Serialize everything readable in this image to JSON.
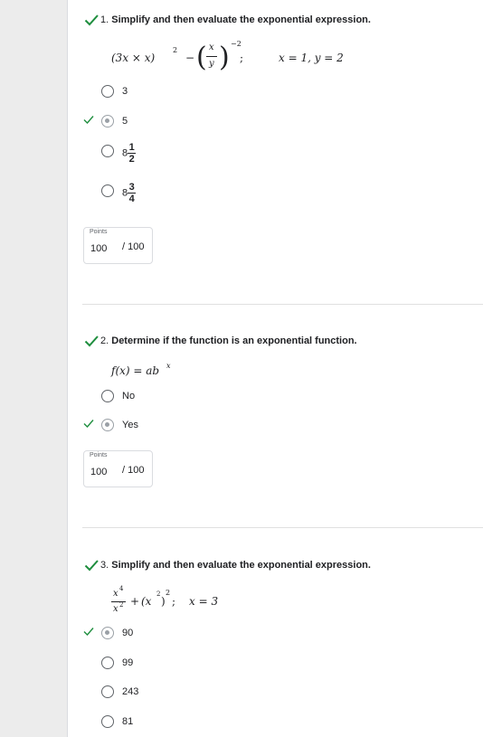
{
  "colors": {
    "check": "#1e8e3e",
    "selected_radio": "#9aa0a6",
    "divider": "#e0e0e0"
  },
  "questions": [
    {
      "number": "1.",
      "title": "Simplify and then evaluate the exponential expression.",
      "status_icon": "checkmark-icon",
      "expression": {
        "part1": "(3x × x)",
        "part1_exp": "2",
        "minus": "−",
        "frac_num": "x",
        "frac_den": "y",
        "part2_exp": "−2",
        "sep": ";",
        "given": "x = 1, y = 2"
      },
      "options": [
        {
          "label": "3",
          "selected": false,
          "correct": false
        },
        {
          "label": "5",
          "selected": true,
          "correct": true
        },
        {
          "whole": "8",
          "num": "1",
          "den": "2",
          "selected": false,
          "correct": false
        },
        {
          "whole": "8",
          "num": "3",
          "den": "4",
          "selected": false,
          "correct": false
        }
      ],
      "points_label": "Points",
      "points_value": "100",
      "points_total": "/ 100"
    },
    {
      "number": "2.",
      "title": "Determine if the function is an exponential function.",
      "status_icon": "checkmark-icon",
      "expression": {
        "lhs": "f(x) = ab",
        "exp": "x"
      },
      "options": [
        {
          "label": "No",
          "selected": false,
          "correct": false
        },
        {
          "label": "Yes",
          "selected": true,
          "correct": true
        }
      ],
      "points_label": "Points",
      "points_value": "100",
      "points_total": "/ 100"
    },
    {
      "number": "3.",
      "title": "Simplify and then evaluate the exponential expression.",
      "status_icon": "checkmark-icon",
      "expression": {
        "num": "x",
        "num_exp": "4",
        "den": "x",
        "den_exp": "2",
        "plus": "+",
        "inner": "(x",
        "inner_exp": "2",
        "close": ")",
        "outer_exp": "2",
        "sep": ";",
        "given": "x = 3"
      },
      "options": [
        {
          "label": "90",
          "selected": true,
          "correct": true
        },
        {
          "label": "99",
          "selected": false,
          "correct": false
        },
        {
          "label": "243",
          "selected": false,
          "correct": false
        },
        {
          "label": "81",
          "selected": false,
          "correct": false
        }
      ]
    }
  ]
}
